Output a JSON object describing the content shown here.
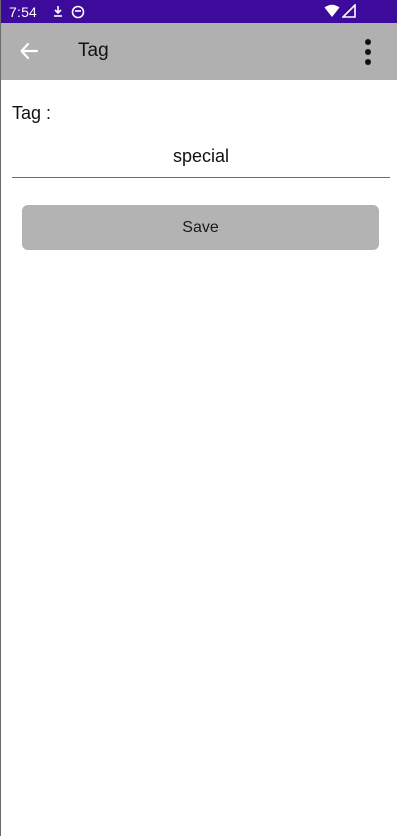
{
  "status_bar": {
    "time": "7:54",
    "icons": [
      "download-status-icon",
      "notification-circle-icon",
      "wifi-icon",
      "signal-icon"
    ],
    "background_color": "#3c0b9c"
  },
  "app_bar": {
    "title": "Tag",
    "back_icon": "arrow-left-icon",
    "overflow_icon": "more-vert-icon",
    "background_color": "#b0b0b0"
  },
  "form": {
    "tag_label": "Tag :",
    "tag_value": "special",
    "underline_color": "#e53935"
  },
  "actions": {
    "save_label": "Save",
    "button_color": "#b3b3b3"
  }
}
